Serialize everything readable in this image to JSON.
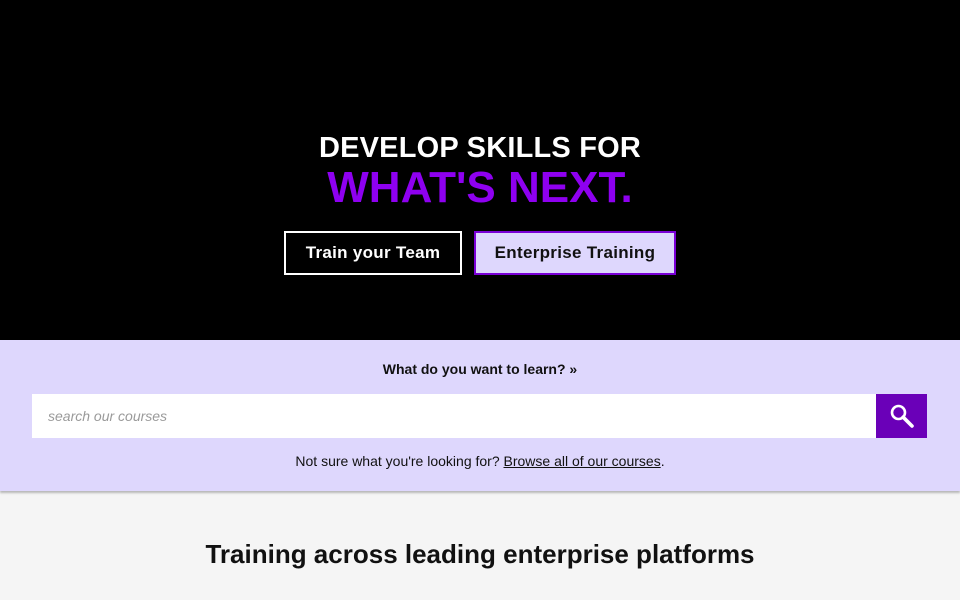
{
  "hero": {
    "headline_line1": "DEVELOP SKILLS FOR",
    "headline_line2": "WHAT'S NEXT.",
    "train_team_label": "Train your Team",
    "enterprise_label": "Enterprise Training"
  },
  "search": {
    "question": "What do you want to learn? »",
    "placeholder": "search our courses",
    "value": "",
    "button_icon": "search-icon",
    "browse_prefix": "Not sure what you're looking for? ",
    "browse_link": "Browse all of our courses",
    "browse_suffix": "."
  },
  "platforms": {
    "title": "Training across leading enterprise platforms"
  },
  "colors": {
    "hero_bg": "#000000",
    "accent_purple": "#8e00f0",
    "search_band_bg": "#ded7fd",
    "search_button_bg": "#6a00b8"
  }
}
